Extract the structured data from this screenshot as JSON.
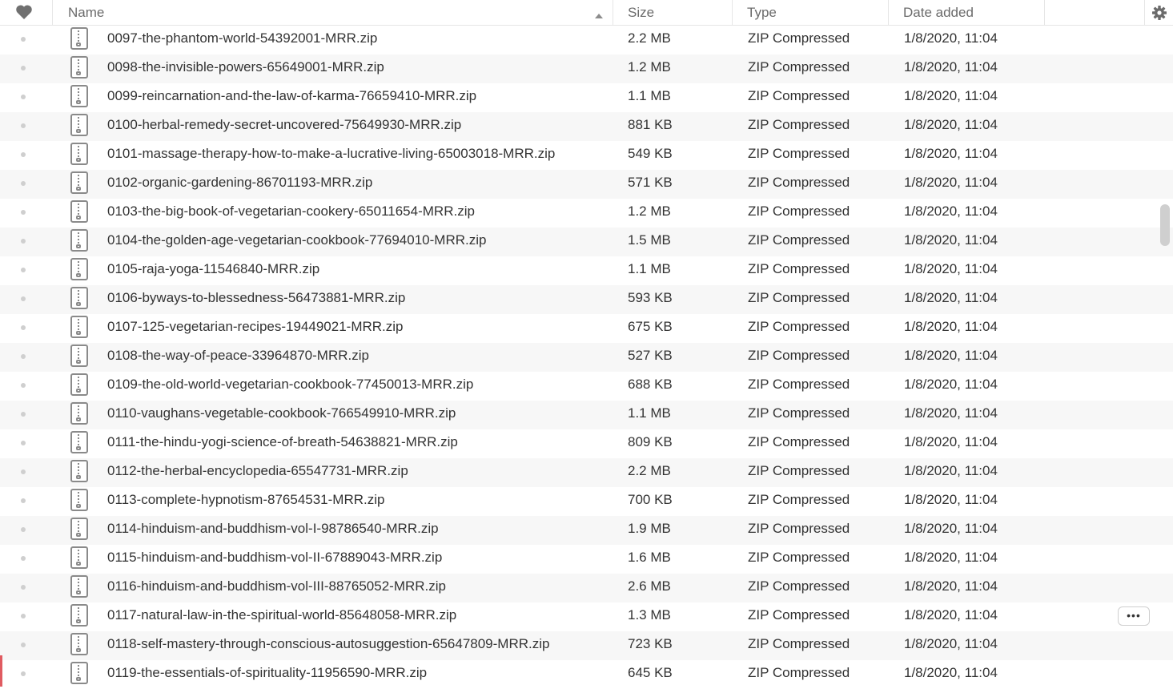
{
  "header": {
    "favorite_icon": "heart-icon",
    "name_label": "Name",
    "size_label": "Size",
    "type_label": "Type",
    "date_label": "Date added",
    "sort_icon": "sort-ascending-icon",
    "settings_icon": "gear-icon"
  },
  "more_label": "•••",
  "files": [
    {
      "name": "0097-the-phantom-world-54392001-MRR.zip",
      "size": "2.2 MB",
      "type": "ZIP Compressed",
      "date": "1/8/2020, 11:04"
    },
    {
      "name": "0098-the-invisible-powers-65649001-MRR.zip",
      "size": "1.2 MB",
      "type": "ZIP Compressed",
      "date": "1/8/2020, 11:04"
    },
    {
      "name": "0099-reincarnation-and-the-law-of-karma-76659410-MRR.zip",
      "size": "1.1 MB",
      "type": "ZIP Compressed",
      "date": "1/8/2020, 11:04"
    },
    {
      "name": "0100-herbal-remedy-secret-uncovered-75649930-MRR.zip",
      "size": "881 KB",
      "type": "ZIP Compressed",
      "date": "1/8/2020, 11:04"
    },
    {
      "name": "0101-massage-therapy-how-to-make-a-lucrative-living-65003018-MRR.zip",
      "size": "549 KB",
      "type": "ZIP Compressed",
      "date": "1/8/2020, 11:04"
    },
    {
      "name": "0102-organic-gardening-86701193-MRR.zip",
      "size": "571 KB",
      "type": "ZIP Compressed",
      "date": "1/8/2020, 11:04"
    },
    {
      "name": "0103-the-big-book-of-vegetarian-cookery-65011654-MRR.zip",
      "size": "1.2 MB",
      "type": "ZIP Compressed",
      "date": "1/8/2020, 11:04"
    },
    {
      "name": "0104-the-golden-age-vegetarian-cookbook-77694010-MRR.zip",
      "size": "1.5 MB",
      "type": "ZIP Compressed",
      "date": "1/8/2020, 11:04"
    },
    {
      "name": "0105-raja-yoga-11546840-MRR.zip",
      "size": "1.1 MB",
      "type": "ZIP Compressed",
      "date": "1/8/2020, 11:04"
    },
    {
      "name": "0106-byways-to-blessedness-56473881-MRR.zip",
      "size": "593 KB",
      "type": "ZIP Compressed",
      "date": "1/8/2020, 11:04"
    },
    {
      "name": "0107-125-vegetarian-recipes-19449021-MRR.zip",
      "size": "675 KB",
      "type": "ZIP Compressed",
      "date": "1/8/2020, 11:04"
    },
    {
      "name": "0108-the-way-of-peace-33964870-MRR.zip",
      "size": "527 KB",
      "type": "ZIP Compressed",
      "date": "1/8/2020, 11:04"
    },
    {
      "name": "0109-the-old-world-vegetarian-cookbook-77450013-MRR.zip",
      "size": "688 KB",
      "type": "ZIP Compressed",
      "date": "1/8/2020, 11:04"
    },
    {
      "name": "0110-vaughans-vegetable-cookbook-766549910-MRR.zip",
      "size": "1.1 MB",
      "type": "ZIP Compressed",
      "date": "1/8/2020, 11:04"
    },
    {
      "name": "0111-the-hindu-yogi-science-of-breath-54638821-MRR.zip",
      "size": "809 KB",
      "type": "ZIP Compressed",
      "date": "1/8/2020, 11:04"
    },
    {
      "name": "0112-the-herbal-encyclopedia-65547731-MRR.zip",
      "size": "2.2 MB",
      "type": "ZIP Compressed",
      "date": "1/8/2020, 11:04"
    },
    {
      "name": "0113-complete-hypnotism-87654531-MRR.zip",
      "size": "700 KB",
      "type": "ZIP Compressed",
      "date": "1/8/2020, 11:04"
    },
    {
      "name": "0114-hinduism-and-buddhism-vol-I-98786540-MRR.zip",
      "size": "1.9 MB",
      "type": "ZIP Compressed",
      "date": "1/8/2020, 11:04"
    },
    {
      "name": "0115-hinduism-and-buddhism-vol-II-67889043-MRR.zip",
      "size": "1.6 MB",
      "type": "ZIP Compressed",
      "date": "1/8/2020, 11:04"
    },
    {
      "name": "0116-hinduism-and-buddhism-vol-III-88765052-MRR.zip",
      "size": "2.6 MB",
      "type": "ZIP Compressed",
      "date": "1/8/2020, 11:04"
    },
    {
      "name": "0117-natural-law-in-the-spiritual-world-85648058-MRR.zip",
      "size": "1.3 MB",
      "type": "ZIP Compressed",
      "date": "1/8/2020, 11:04"
    },
    {
      "name": "0118-self-mastery-through-conscious-autosuggestion-65647809-MRR.zip",
      "size": "723 KB",
      "type": "ZIP Compressed",
      "date": "1/8/2020, 11:04"
    },
    {
      "name": "0119-the-essentials-of-spirituality-11956590-MRR.zip",
      "size": "645 KB",
      "type": "ZIP Compressed",
      "date": "1/8/2020, 11:04"
    }
  ]
}
